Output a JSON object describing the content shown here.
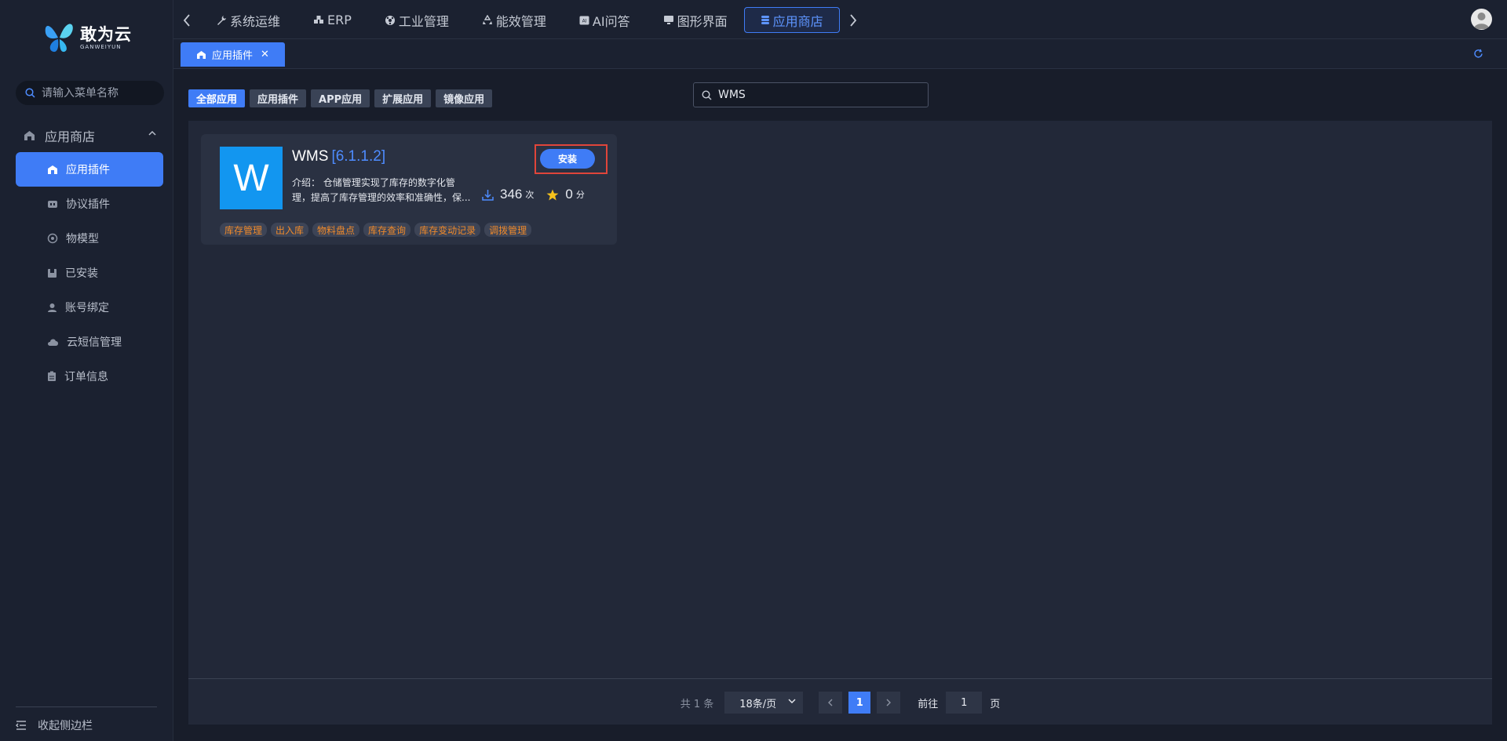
{
  "brand": {
    "name_cn": "敢为云",
    "name_en": "GANWEIYUN"
  },
  "sidebar": {
    "search_placeholder": "请输入菜单名称",
    "group": {
      "label": "应用商店"
    },
    "items": [
      {
        "label": "应用插件",
        "icon": "store-icon",
        "active": true
      },
      {
        "label": "协议插件",
        "icon": "plug-icon"
      },
      {
        "label": "物模型",
        "icon": "model-icon"
      },
      {
        "label": "已安装",
        "icon": "installed-icon"
      },
      {
        "label": "账号绑定",
        "icon": "user-icon"
      },
      {
        "label": "云短信管理",
        "icon": "cloud-icon"
      },
      {
        "label": "订单信息",
        "icon": "clipboard-icon"
      }
    ],
    "collapse_label": "收起侧边栏"
  },
  "topnav": {
    "items": [
      {
        "label": "系统运维",
        "icon": "wrench-icon"
      },
      {
        "label": "ERP",
        "icon": "cubes-icon"
      },
      {
        "label": "工业管理",
        "icon": "industry-icon"
      },
      {
        "label": "能效管理",
        "icon": "recycle-icon"
      },
      {
        "label": "AI问答",
        "icon": "ai-icon"
      },
      {
        "label": "图形界面",
        "icon": "monitor-icon"
      },
      {
        "label": "应用商店",
        "icon": "database-icon",
        "active": true
      }
    ]
  },
  "tabs": [
    {
      "label": "应用插件",
      "icon": "store-icon"
    }
  ],
  "filters": [
    {
      "label": "全部应用",
      "active": true
    },
    {
      "label": "应用插件"
    },
    {
      "label": "APP应用"
    },
    {
      "label": "扩展应用"
    },
    {
      "label": "镜像应用"
    }
  ],
  "search": {
    "value": "WMS"
  },
  "card": {
    "icon_letter": "W",
    "name": "WMS",
    "version": "[6.1.1.2]",
    "desc_line1": "介绍： 仓储管理实现了库存的数字化管",
    "desc_line2": "理，提高了库存管理的效率和准确性，保...",
    "install_label": "安装",
    "downloads": "346",
    "downloads_unit": "次",
    "rating": "0",
    "rating_unit": "分",
    "tags": [
      "库存管理",
      "出入库",
      "物料盘点",
      "库存查询",
      "库存变动记录",
      "调拨管理"
    ]
  },
  "pager": {
    "total": "共 1 条",
    "page_size": "18条/页",
    "current": "1",
    "goto_label": "前往",
    "goto_value": "1",
    "page_unit": "页"
  },
  "colors": {
    "accent": "#3f7cf6",
    "tag_text": "#f08a2b",
    "highlight_border": "#e0453a",
    "app_icon_bg": "#1296f0"
  }
}
